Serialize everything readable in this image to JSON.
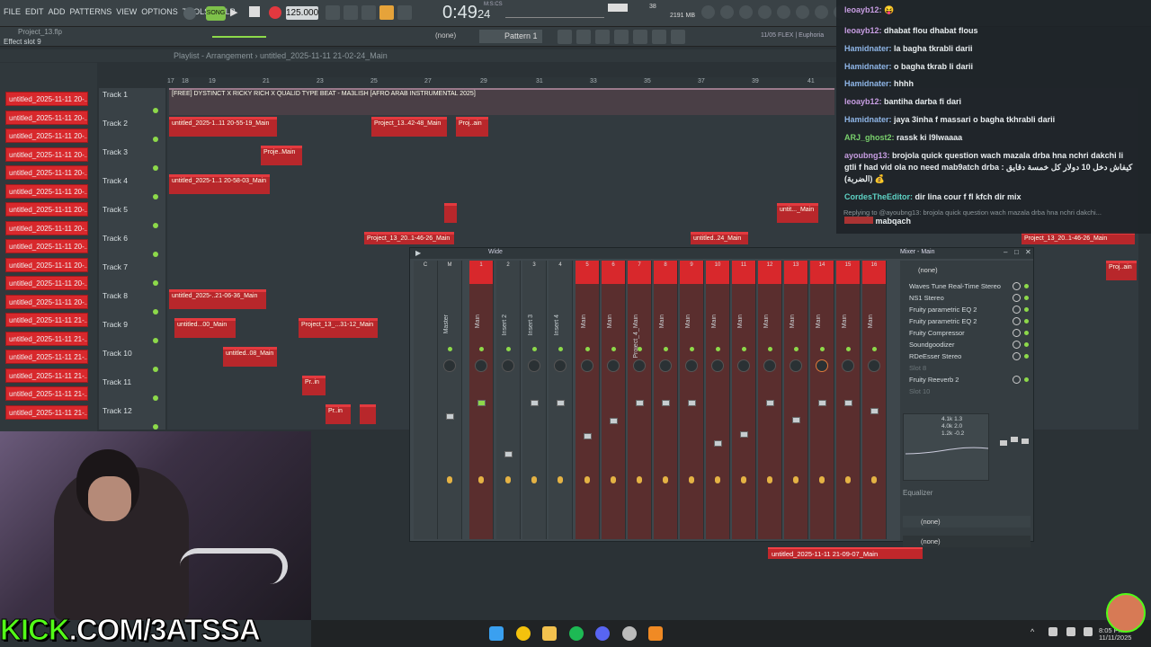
{
  "menu": [
    "FILE",
    "EDIT",
    "ADD",
    "PATTERNS",
    "VIEW",
    "OPTIONS",
    "TOOLS",
    "HELP"
  ],
  "transport": {
    "song_label": "SONG",
    "tempo": "125.000",
    "time": "0:49",
    "time_sub": "24",
    "time_label": "M:S:CS",
    "memory": "2191 MB",
    "cpu": "38"
  },
  "project": {
    "file": "Project_13.flp",
    "hint": "Effect slot 9",
    "pattern": "Pattern 1",
    "none": "(none)",
    "flex": "11/05  FLEX | Euphoria"
  },
  "playlist": {
    "title": "Playlist - Arrangement",
    "breadcrumb": "untitled_2025-11-11 21-02-24_Main"
  },
  "ruler": [
    "17",
    "18",
    "19",
    "21",
    "23",
    "25",
    "27",
    "29",
    "31",
    "33",
    "35",
    "37",
    "39",
    "41"
  ],
  "patterns": [
    "untitled_2025-11-11 20-...",
    "untitled_2025-11-11 20-...",
    "untitled_2025-11-11 20-...",
    "untitled_2025-11-11 20-...",
    "untitled_2025-11-11 20-...",
    "untitled_2025-11-11 20-...",
    "untitled_2025-11-11 20-...",
    "untitled_2025-11-11 20-...",
    "untitled_2025-11-11 20-...",
    "untitled_2025-11-11 20-...",
    "untitled_2025-11-11 20-...",
    "untitled_2025-11-11 20-...",
    "untitled_2025-11-11 21-...",
    "untitled_2025-11-11 21-...",
    "untitled_2025-11-11 21-...",
    "untitled_2025-11-11 21-...",
    "untitled_2025-11-11 21-...",
    "untitled_2025-11-11 21-...",
    "untitled_2025-11-11 21-..."
  ],
  "tracks": [
    "Track 1",
    "Track 2",
    "Track 3",
    "Track 4",
    "Track 5",
    "Track 6",
    "Track 7",
    "Track 8",
    "Track 9",
    "Track 10",
    "Track 11",
    "Track 12"
  ],
  "clips": {
    "c1": "[FREE] DYSTINCT X RICKY RICH X QUALID TYPE BEAT - MA3LISH [AFRO ARAB INSTRUMENTAL 2025]",
    "c2": "untitled_2025-1..11 20-55-19_Main",
    "c3": "Project_13..42-48_Main",
    "c4": "Proj..ain",
    "c5": "Proje..Main",
    "c6": "untitled_2025-1..1 20-58-03_Main",
    "c7": "Project_13_20..1-46-26_Main",
    "c8": "untitled..24_Main",
    "c9": "untit..._Main",
    "c10": "untitled_2025-..21-06-36_Main",
    "c11": "untitled...00_Main",
    "c12": "Project_13_...31-12_Main",
    "c13": "untitled..08_Main",
    "c14": "Pr..in",
    "c15": "Pr..in",
    "c16": "Project_13_20..1-46-26_Main",
    "c17": "Proj..ain",
    "big": "untitled_2025-11-11 21-09-07_Main"
  },
  "mixer": {
    "title": "Mixer - Main",
    "wide": "Wide",
    "strips": [
      {
        "num": "C",
        "label": "",
        "kind": "grey"
      },
      {
        "num": "M",
        "label": "Master",
        "kind": "grey"
      },
      {
        "num": "1",
        "label": "Main",
        "kind": "red"
      },
      {
        "num": "2",
        "label": "Insert 2",
        "kind": "grey"
      },
      {
        "num": "3",
        "label": "Insert 3",
        "kind": "grey"
      },
      {
        "num": "4",
        "label": "Insert 4",
        "kind": "grey"
      },
      {
        "num": "5",
        "label": "Main",
        "kind": "red"
      },
      {
        "num": "6",
        "label": "Main",
        "kind": "red"
      },
      {
        "num": "7",
        "label": "Project_4_Main",
        "kind": "red"
      },
      {
        "num": "8",
        "label": "Main",
        "kind": "red"
      },
      {
        "num": "9",
        "label": "Main",
        "kind": "red"
      },
      {
        "num": "10",
        "label": "Main",
        "kind": "red"
      },
      {
        "num": "11",
        "label": "Main",
        "kind": "red"
      },
      {
        "num": "12",
        "label": "Main",
        "kind": "red"
      },
      {
        "num": "13",
        "label": "Main",
        "kind": "red"
      },
      {
        "num": "14",
        "label": "Main",
        "kind": "red"
      },
      {
        "num": "15",
        "label": "Main",
        "kind": "red"
      },
      {
        "num": "16",
        "label": "Main",
        "kind": "red"
      }
    ],
    "fx_none": "(none)",
    "fx": [
      "Waves Tune Real-Time Stereo",
      "NS1 Stereo",
      "Fruity parametric EQ 2",
      "Fruity parametric EQ 2",
      "Fruity Compressor",
      "Soundgoodizer",
      "RDeEsser Stereo",
      "Slot 8",
      "Fruity Reeverb 2",
      "Slot 10"
    ],
    "eq_vals": [
      "4.1k 1.3",
      "4.0k 2.0",
      "1.2k -0.2"
    ],
    "eq_label": "Equalizer",
    "out1": "(none)",
    "out2": "(none)"
  },
  "chat": [
    {
      "user": "leoayb12:",
      "msg": "",
      "cls": "u3"
    },
    {
      "user": "leoayb12:",
      "msg": "dhabat flou dhabat flous",
      "cls": "u3"
    },
    {
      "user": "Hamidnater:",
      "msg": "la bagha tkrabli darii",
      "cls": "u"
    },
    {
      "user": "Hamidnater:",
      "msg": "o bagha tkrab li darii",
      "cls": "u"
    },
    {
      "user": "Hamidnater:",
      "msg": "hhhh",
      "cls": "u"
    },
    {
      "user": "leoayb12:",
      "msg": "bantiha darba fi dari",
      "cls": "u3"
    },
    {
      "user": "Hamidnater:",
      "msg": "jaya 3inha f massari o bagha tkhrabli darii",
      "cls": "u"
    },
    {
      "user": "ARJ_ghost2:",
      "msg": "rassk ki l9lwaaaa",
      "cls": "u2"
    },
    {
      "user": "ayoubng13:",
      "msg": "brojola quick question wach mazala drba hna nchri dakchi li",
      "cls": "u3"
    },
    {
      "user": "",
      "msg": "gtli f had vid ola no need mab9atch drba : كيفاش دخل 10 دولار كل خمسة دقايق",
      "cls": "u3"
    },
    {
      "user": "",
      "msg": "(الضربة) 💰",
      "cls": "u3"
    },
    {
      "user": "CordesTheEditor:",
      "msg": "dir lina cour f fl kfch dir mix",
      "cls": "u4"
    },
    {
      "user": "",
      "msg": "mabqach",
      "cls": "u5"
    }
  ],
  "replying": "Replying to @ayoubng13: brojola quick question wach mazala drba hna nchri dakchi...",
  "kick": {
    "prefix": "KICK",
    "rest": ".COM/3ATSSA"
  },
  "clock": {
    "time": "8:05 PM",
    "date": "11/11/2025"
  },
  "colors": {
    "accent_red": "#d8282c",
    "green": "#8dd94a",
    "kick": "#53fc18"
  }
}
